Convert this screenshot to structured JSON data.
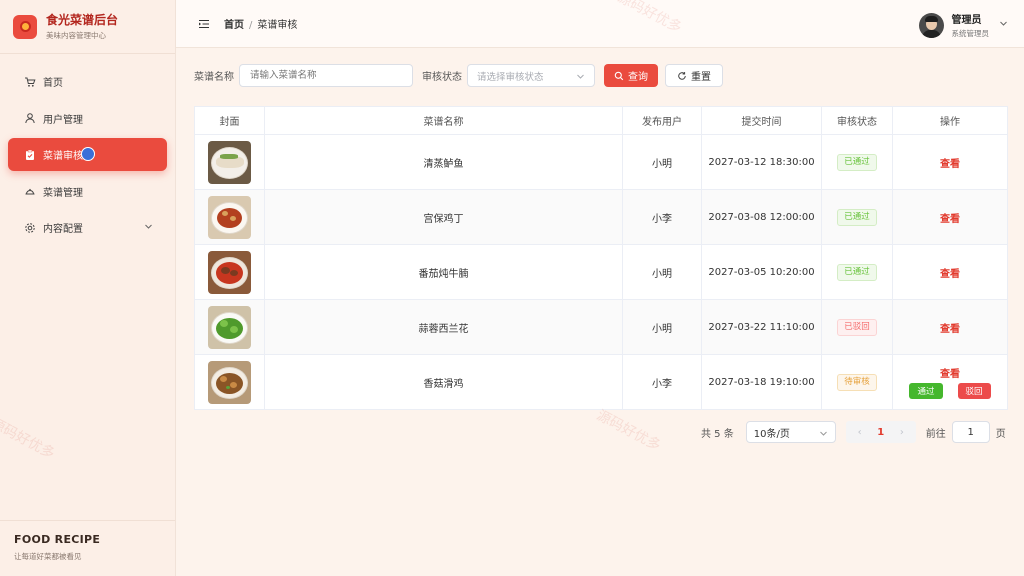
{
  "brand": {
    "title": "食光菜谱后台",
    "subtitle": "美味内容管理中心"
  },
  "sidebar": {
    "items": [
      {
        "label": "首页",
        "icon": "cart-icon"
      },
      {
        "label": "用户管理",
        "icon": "user-icon"
      },
      {
        "label": "菜谱审核",
        "icon": "clipboard-check-icon",
        "active": true
      },
      {
        "label": "菜谱管理",
        "icon": "cloche-icon"
      },
      {
        "label": "内容配置",
        "icon": "gear-icon",
        "expandable": true
      }
    ],
    "footer": {
      "title": "FOOD RECIPE",
      "subtitle": "让每道好菜都被看见"
    }
  },
  "header": {
    "breadcrumb": [
      "首页",
      "菜谱审核"
    ],
    "user": {
      "name": "管理员",
      "role": "系统管理员"
    }
  },
  "filters": {
    "name_label": "菜谱名称",
    "name_placeholder": "请输入菜谱名称",
    "status_label": "审核状态",
    "status_placeholder": "请选择审核状态",
    "query_button": "查询",
    "reset_button": "重置"
  },
  "table": {
    "columns": [
      "封面",
      "菜谱名称",
      "发布用户",
      "提交时间",
      "审核状态",
      "操作"
    ],
    "rows": [
      {
        "name": "清蒸鲈鱼",
        "user": "小明",
        "time": "2027-03-12 18:30:00",
        "status": "已通过",
        "status_type": "pass",
        "action": "查看"
      },
      {
        "name": "宫保鸡丁",
        "user": "小李",
        "time": "2027-03-08 12:00:00",
        "status": "已通过",
        "status_type": "pass",
        "action": "查看"
      },
      {
        "name": "番茄炖牛腩",
        "user": "小明",
        "time": "2027-03-05 10:20:00",
        "status": "已通过",
        "status_type": "pass",
        "action": "查看"
      },
      {
        "name": "蒜蓉西兰花",
        "user": "小明",
        "time": "2027-03-22 11:10:00",
        "status": "已驳回",
        "status_type": "reject",
        "action": "查看"
      },
      {
        "name": "香菇滑鸡",
        "user": "小李",
        "time": "2027-03-18 19:10:00",
        "status": "待审核",
        "status_type": "pending",
        "action": "查看",
        "approve": "通过",
        "reject": "驳回"
      }
    ]
  },
  "pagination": {
    "total": "共 5 条",
    "page_size": "10条/页",
    "current_page": "1",
    "goto_label": "前往",
    "goto_value": "1",
    "page_unit": "页"
  },
  "watermark": "源码好优多",
  "colors": {
    "accent": "#ea4b3e",
    "pass": "#67c23a",
    "reject": "#f56c6c",
    "pending": "#e6a23c"
  }
}
